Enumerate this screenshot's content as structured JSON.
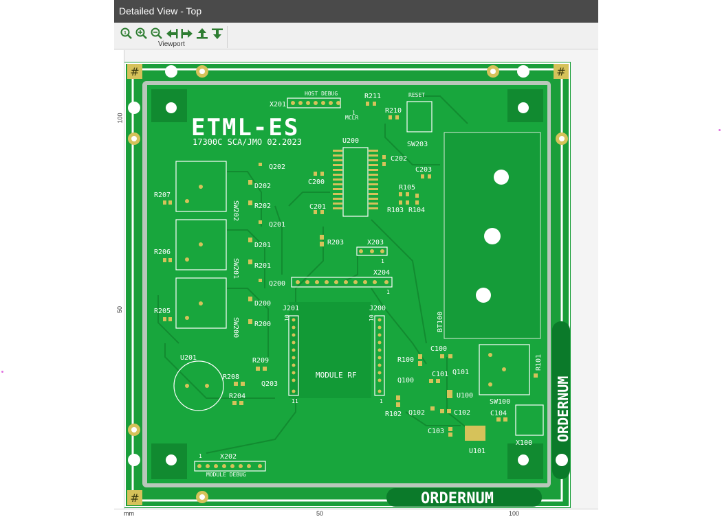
{
  "window": {
    "title": "Detailed View - Top"
  },
  "toolbar": {
    "group_label": "Viewport",
    "buttons": [
      {
        "name": "zoom-fit",
        "icon": "zoom-fit-icon"
      },
      {
        "name": "zoom-in",
        "icon": "zoom-in-icon"
      },
      {
        "name": "zoom-out",
        "icon": "zoom-out-icon"
      },
      {
        "name": "pan-left",
        "icon": "arrow-left-icon"
      },
      {
        "name": "pan-right",
        "icon": "arrow-right-icon"
      },
      {
        "name": "pan-up",
        "icon": "arrow-up-icon"
      },
      {
        "name": "pan-down",
        "icon": "arrow-down-icon"
      }
    ]
  },
  "rulers": {
    "unit": "mm",
    "bottom_labels": [
      "50",
      "100"
    ],
    "left_labels": [
      "100",
      "50"
    ]
  },
  "pcb": {
    "logo": "ETML-ES",
    "subtitle": "17300C SCA/JMO 02.2023",
    "brand": "ORDERNUM",
    "colors": {
      "board": "#18a63d",
      "edge": "#b9c7bb",
      "silk": "#ffffff",
      "pad": "#d6c25a"
    },
    "labels": {
      "host_debug": "HOST DEBUG",
      "reset": "RESET",
      "mclr": "MCLR",
      "module_debug": "MODULE DEBUG",
      "module_rf": "MODULE RF",
      "pin1": "1",
      "pin10": "10",
      "pin11": "11"
    },
    "refs": [
      "X201",
      "R211",
      "R210",
      "SW203",
      "U200",
      "C202",
      "C203",
      "Q202",
      "D202",
      "R202",
      "C200",
      "C201",
      "R105",
      "R103",
      "R104",
      "R207",
      "SW202",
      "Q201",
      "D201",
      "R206",
      "R201",
      "SW201",
      "R203",
      "X203",
      "X204",
      "Q200",
      "R205",
      "D200",
      "R200",
      "SW200",
      "J201",
      "J200",
      "BT100",
      "R100",
      "C100",
      "Q101",
      "C101",
      "R101",
      "Q100",
      "U100",
      "U201",
      "R209",
      "R208",
      "Q203",
      "R204",
      "R102",
      "Q102",
      "C102",
      "C104",
      "C103",
      "U101",
      "X100",
      "SW100",
      "X202"
    ]
  }
}
